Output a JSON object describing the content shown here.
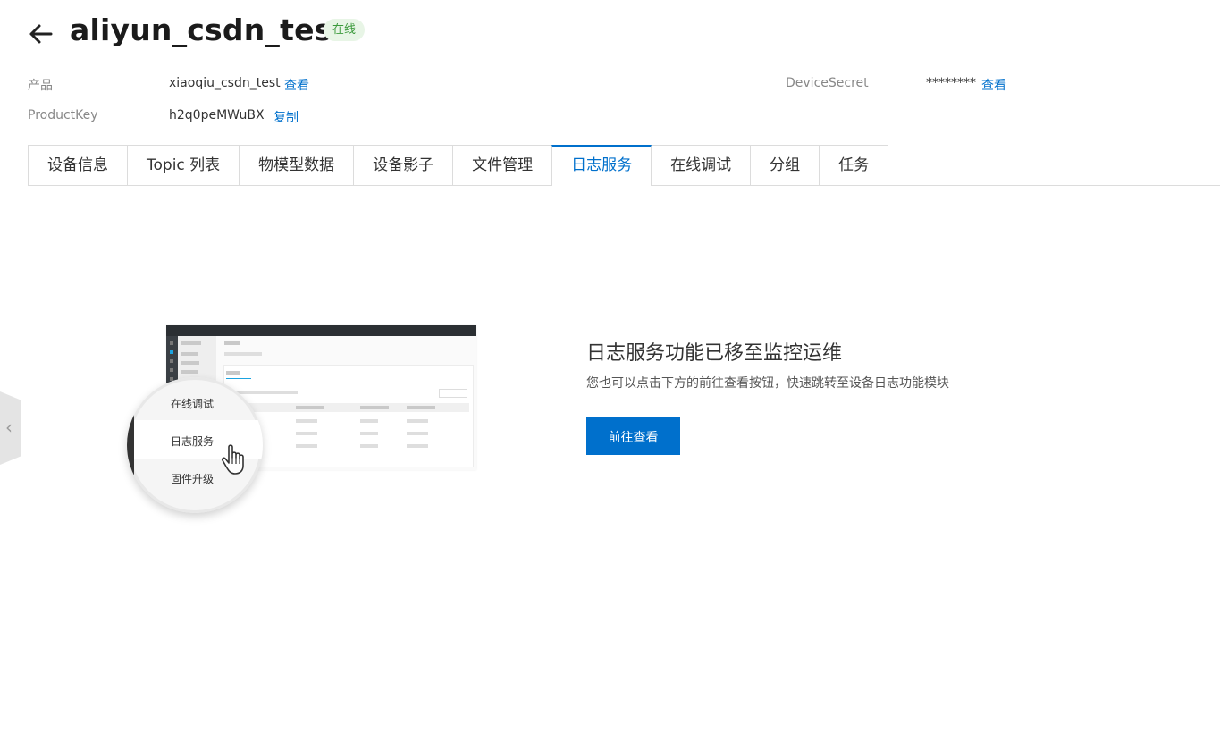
{
  "header": {
    "title": "aliyun_csdn_test",
    "status": "在线",
    "back_icon": "arrow-left-icon"
  },
  "meta": {
    "product_label": "产品",
    "product_value": "xiaoqiu_csdn_test",
    "product_link": "查看",
    "secret_label": "DeviceSecret",
    "secret_value": "********",
    "secret_link": "查看",
    "key_label": "ProductKey",
    "key_value": "h2q0peMWuBX",
    "key_link": "复制"
  },
  "tabs": [
    {
      "label": "设备信息"
    },
    {
      "label": "Topic 列表"
    },
    {
      "label": "物模型数据"
    },
    {
      "label": "设备影子"
    },
    {
      "label": "文件管理"
    },
    {
      "label": "日志服务",
      "active": true
    },
    {
      "label": "在线调试"
    },
    {
      "label": "分组"
    },
    {
      "label": "任务"
    }
  ],
  "illustration": {
    "menu_items": [
      "在线调试",
      "日志服务",
      "固件升级"
    ],
    "icon": "hand-pointer-icon"
  },
  "content": {
    "title": "日志服务功能已移至监控运维",
    "description": "您也可以点击下方的前往查看按钮，快速跳转至设备日志功能模块",
    "button": "前往查看"
  },
  "colors": {
    "accent": "#0070cc",
    "status_bg": "#e8f5e6",
    "status_text": "#3c9a3c"
  }
}
